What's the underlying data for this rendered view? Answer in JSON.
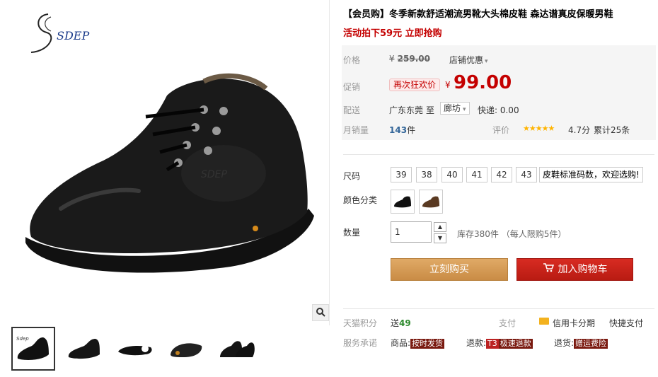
{
  "product": {
    "title": "【会员购】冬季新款舒适潮流男靴大头棉皮鞋 森达谱真皮保暖男鞋",
    "promo": "活动拍下59元 立即抢购"
  },
  "brand": {
    "logo_text": "SDEP"
  },
  "price": {
    "label": "价格",
    "currency": "¥",
    "original": "259.00",
    "shop_promo": "店铺优惠",
    "promo_label": "促销",
    "badge": "再次狂欢价",
    "current": "99.00"
  },
  "shipping": {
    "label": "配送",
    "from": "广东东莞",
    "to_word": "至",
    "city": "廊坊",
    "fee": "快递: 0.00"
  },
  "sales": {
    "label": "月销量",
    "count": "143",
    "unit": "件",
    "rating_label": "评价",
    "stars": "★★★★★",
    "rating": "4.7分",
    "reviews": "累计25条"
  },
  "size": {
    "label": "尺码",
    "options": [
      "39",
      "38",
      "40",
      "41",
      "42",
      "43"
    ],
    "note": "皮鞋标准码数，欢迎选购!"
  },
  "color": {
    "label": "颜色分类"
  },
  "quantity": {
    "label": "数量",
    "value": "1",
    "stock": "库存380件 （每人限购5件）"
  },
  "actions": {
    "buy": "立刻购买",
    "cart": "加入购物车"
  },
  "points": {
    "label": "天猫积分",
    "prefix": "送",
    "value": "49",
    "pay_label": "支付",
    "credit": "信用卡分期",
    "quick": "快捷支付"
  },
  "service": {
    "label": "服务承诺",
    "goods_label": "商品:",
    "goods_tag": "按时发货",
    "refund_label": "退款:",
    "refund_t3": "T3",
    "refund_tag": "极速退款",
    "return_label": "退货:",
    "return_tag": "赠运费险"
  },
  "colors": {
    "accent_red": "#c40000",
    "buy_orange": "#d69e5a",
    "cart_red": "#c8231a",
    "price_bg": "#f5f5f5"
  }
}
